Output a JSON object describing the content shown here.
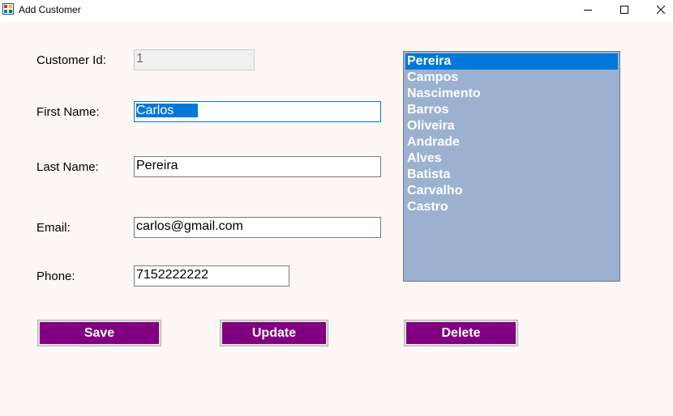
{
  "window": {
    "title": "Add Customer",
    "controls": [
      "minimize",
      "maximize",
      "close"
    ]
  },
  "form": {
    "customer_id": {
      "label": "Customer Id:",
      "value": "1",
      "enabled": false
    },
    "first_name": {
      "label": "First Name:",
      "value": "Carlos",
      "focused": true,
      "selected": true
    },
    "last_name": {
      "label": "Last Name:",
      "value": "Pereira"
    },
    "email": {
      "label": "Email:",
      "value": "carlos@gmail.com"
    },
    "phone": {
      "label": "Phone:",
      "value": "7152222222"
    }
  },
  "customer_list": {
    "selected_index": 0,
    "items": [
      "Pereira",
      "Campos",
      "Nascimento",
      "Barros",
      "Oliveira",
      "Andrade",
      "Alves",
      "Batista",
      "Carvalho",
      "Castro"
    ]
  },
  "buttons": {
    "save": "Save",
    "update": "Update",
    "delete": "Delete"
  },
  "colors": {
    "window_background": "#fdf7f6",
    "button_fill": "#800080",
    "button_text": "#ffffff",
    "list_background": "#9bb1cf",
    "selection": "#0078d7"
  }
}
